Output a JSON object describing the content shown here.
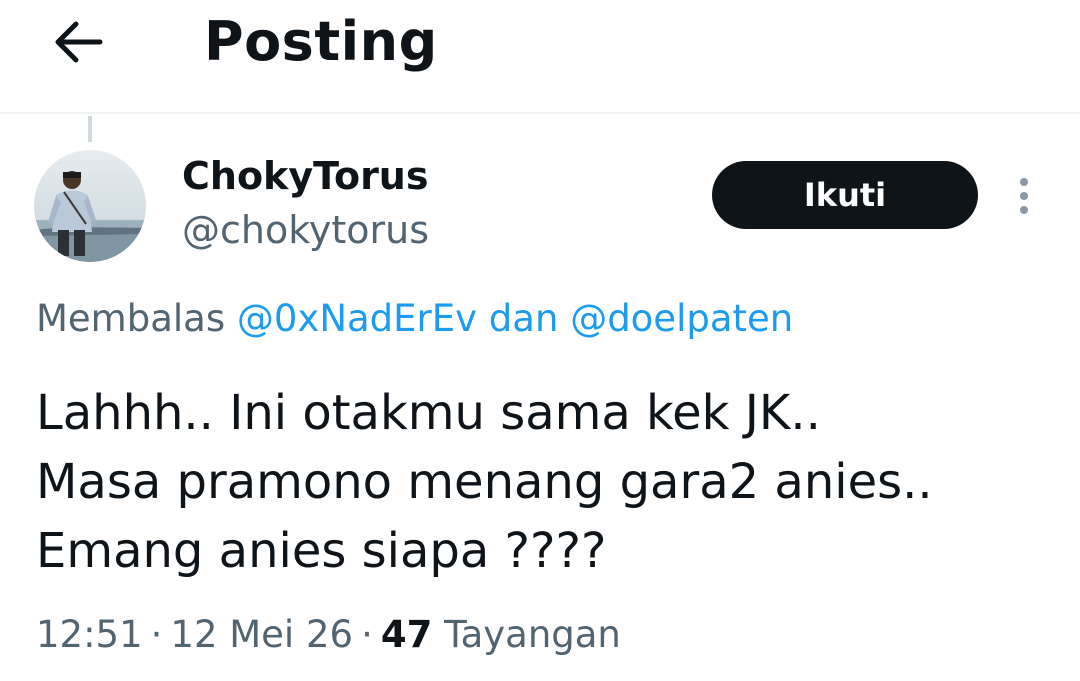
{
  "header": {
    "title": "Posting",
    "back_icon": "arrow-left-icon"
  },
  "tweet": {
    "display_name": "ChokyTorus",
    "handle": "@chokytorus",
    "follow_label": "Ikuti",
    "more_icon": "more-vertical-icon",
    "reply_prefix": "Membalas",
    "reply_mention_1": "@0xNadErEv",
    "reply_conjunction": "dan",
    "reply_mention_2": "@doelpaten",
    "text_lines": [
      "Lahhh.. Ini otakmu sama kek JK..",
      "Masa pramono menang gara2 anies..",
      "Emang anies siapa ????"
    ],
    "time": "12:51",
    "date": "12 Mei 26",
    "views_count": "47",
    "views_label": "Tayangan"
  },
  "colors": {
    "text_primary": "#0f1419",
    "text_secondary": "#536471",
    "link": "#1d9bf0",
    "button_bg": "#0f1419",
    "divider": "#eff3f4"
  }
}
